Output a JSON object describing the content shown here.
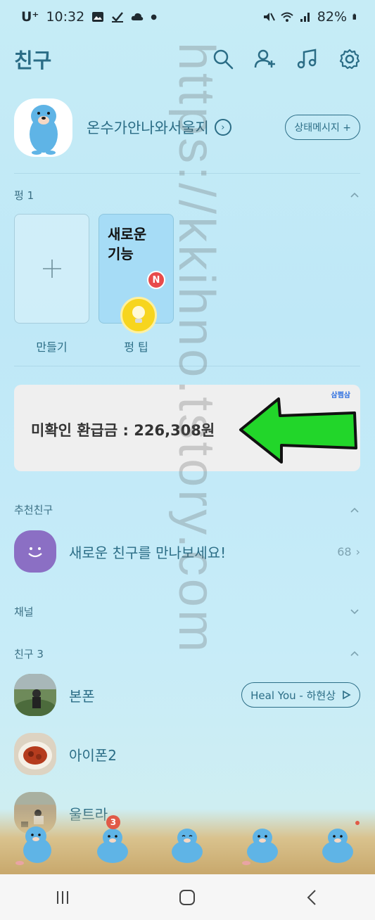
{
  "status_bar": {
    "carrier": "U⁺",
    "time": "10:32",
    "battery": "82%"
  },
  "header": {
    "title": "친구"
  },
  "profile": {
    "name": "온수가안나와서울지",
    "status_button": "상태메시지 +"
  },
  "pyeong": {
    "label": "펑 1",
    "create_label": "만들기",
    "tip_title": "새로운\n기능",
    "tip_badge": "N",
    "tip_label": "펑 팁"
  },
  "ad": {
    "text": "미확인 환급금 : 226,308원",
    "logo": "삼쩜삼",
    "arrow_color": "#22d62a"
  },
  "recommended": {
    "label": "추천친구",
    "item_text": "새로운 친구를 만나보세요!",
    "count": "68"
  },
  "channel": {
    "label": "채널"
  },
  "friends": {
    "label": "친구 3",
    "items": [
      {
        "name": "본폰",
        "music": "Heal You - 하현상"
      },
      {
        "name": "아이폰2"
      },
      {
        "name": "울트라"
      }
    ]
  },
  "bottom_tabs": {
    "badge_count": "3"
  },
  "watermark": "https://kkihno.tstory.com",
  "colors": {
    "accent": "#2b6d86",
    "background": "#c6ecf6",
    "badge_red": "#e84b4b",
    "bulb_yellow": "#f7d51e"
  }
}
